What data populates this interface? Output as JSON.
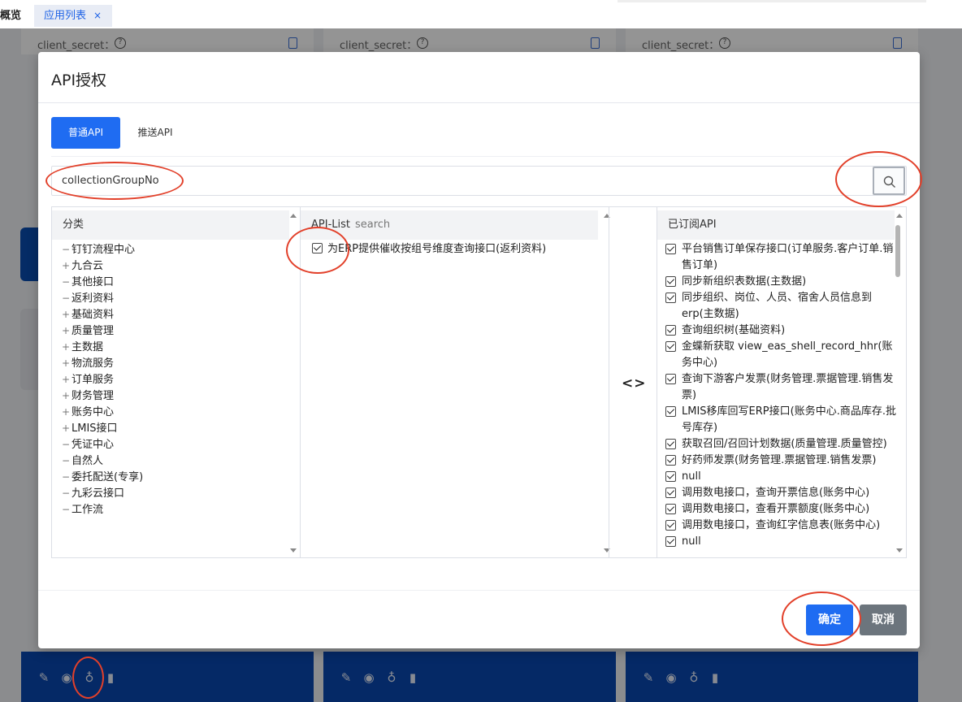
{
  "tabs": {
    "overview": "概览",
    "app_list": "应用列表",
    "close": "×"
  },
  "background": {
    "client_secret_label": "client_secret：",
    "help_glyph": "?"
  },
  "modal": {
    "title": "API授权",
    "tabs": {
      "normal": "普通API",
      "push": "推送API"
    },
    "search_value": "collectionGroupNo",
    "category_panel": {
      "title": "分类",
      "items": [
        {
          "sym": "−",
          "label": "钉钉流程中心"
        },
        {
          "sym": "+",
          "label": "九合云"
        },
        {
          "sym": "−",
          "label": "其他接口"
        },
        {
          "sym": "−",
          "label": "返利资料"
        },
        {
          "sym": "+",
          "label": "基础资料"
        },
        {
          "sym": "+",
          "label": "质量管理"
        },
        {
          "sym": "+",
          "label": "主数据"
        },
        {
          "sym": "+",
          "label": "物流服务"
        },
        {
          "sym": "+",
          "label": "订单服务"
        },
        {
          "sym": "+",
          "label": "财务管理"
        },
        {
          "sym": "+",
          "label": "账务中心"
        },
        {
          "sym": "+",
          "label": "LMIS接口"
        },
        {
          "sym": "−",
          "label": "凭证中心"
        },
        {
          "sym": "−",
          "label": "自然人"
        },
        {
          "sym": "−",
          "label": "委托配送(专享)"
        },
        {
          "sym": "−",
          "label": "九彩云接口"
        },
        {
          "sym": "−",
          "label": "工作流"
        }
      ]
    },
    "api_panel": {
      "title": "API-List",
      "search_hint": "search",
      "items": [
        {
          "label": "为ERP提供催收按组号维度查询接口(返利资料)",
          "checked": true
        }
      ]
    },
    "transfer_icon": "<>",
    "subscribed_panel": {
      "title": "已订阅API",
      "items": [
        {
          "label": "平台销售订单保存接口(订单服务.客户订单.销售订单)",
          "checked": true
        },
        {
          "label": "同步新组织表数据(主数据)",
          "checked": true
        },
        {
          "label": "同步组织、岗位、人员、宿舍人员信息到erp(主数据)",
          "checked": true
        },
        {
          "label": "查询组织树(基础资料)",
          "checked": true
        },
        {
          "label": "金蝶新获取 view_eas_shell_record_hhr(账务中心)",
          "checked": true
        },
        {
          "label": "查询下游客户发票(财务管理.票据管理.销售发票)",
          "checked": true
        },
        {
          "label": "LMIS移库回写ERP接口(账务中心.商品库存.批号库存)",
          "checked": true
        },
        {
          "label": "获取召回/召回计划数据(质量管理.质量管控)",
          "checked": true
        },
        {
          "label": "好药师发票(财务管理.票据管理.销售发票)",
          "checked": true
        },
        {
          "label": "null",
          "checked": true
        },
        {
          "label": "调用数电接口，查询开票信息(账务中心)",
          "checked": true
        },
        {
          "label": "调用数电接口，查看开票额度(账务中心)",
          "checked": true
        },
        {
          "label": "调用数电接口，查询红字信息表(账务中心)",
          "checked": true
        },
        {
          "label": "null",
          "checked": true
        }
      ]
    },
    "buttons": {
      "ok": "确定",
      "cancel": "取消"
    }
  },
  "colors": {
    "primary": "#1f6cf2",
    "cancel": "#6c757d",
    "annotation": "#e2402a",
    "card_bar": "#0a48b0"
  }
}
